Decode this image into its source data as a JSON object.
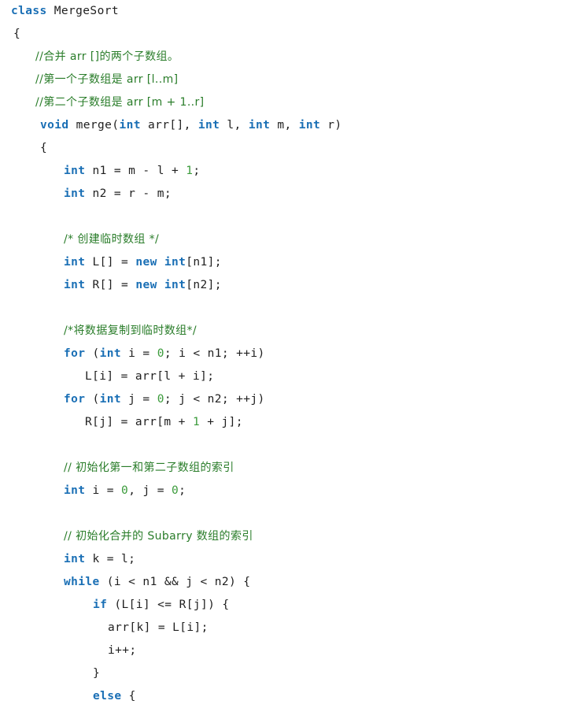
{
  "document": {
    "title": "MergeSort",
    "language": "Java",
    "background_color": "#ffffff",
    "colors": {
      "keyword": "#1a6fb5",
      "comment": "#2a7d2a",
      "number": "#3b9b3b",
      "plain": "#202020",
      "background": "#ffffff"
    }
  },
  "code": {
    "lines": [
      {
        "indent": 0,
        "tokens": [
          {
            "t": "keyword",
            "s": "class"
          },
          {
            "t": "plain",
            "s": " MergeSort"
          }
        ]
      },
      {
        "indent": 1,
        "tokens": [
          {
            "t": "plain",
            "s": "{"
          }
        ]
      },
      {
        "indent": 2,
        "tokens": [
          {
            "t": "comment",
            "s": "//合并 arr []的两个子数组。"
          }
        ]
      },
      {
        "indent": 2,
        "tokens": [
          {
            "t": "comment",
            "s": "//第一个子数组是 arr [l..m]"
          }
        ]
      },
      {
        "indent": 2,
        "tokens": [
          {
            "t": "comment",
            "s": "//第二个子数组是 arr [m + 1..r]"
          }
        ]
      },
      {
        "indent": 3,
        "tokens": [
          {
            "t": "keyword",
            "s": "void"
          },
          {
            "t": "plain",
            "s": " merge("
          },
          {
            "t": "keyword",
            "s": "int"
          },
          {
            "t": "plain",
            "s": " arr[], "
          },
          {
            "t": "keyword",
            "s": "int"
          },
          {
            "t": "plain",
            "s": " l, "
          },
          {
            "t": "keyword",
            "s": "int"
          },
          {
            "t": "plain",
            "s": " m, "
          },
          {
            "t": "keyword",
            "s": "int"
          },
          {
            "t": "plain",
            "s": " r)"
          }
        ]
      },
      {
        "indent": 3,
        "tokens": [
          {
            "t": "plain",
            "s": "{"
          }
        ]
      },
      {
        "indent": 4,
        "tokens": [
          {
            "t": "keyword",
            "s": "int"
          },
          {
            "t": "plain",
            "s": " n1 = m - l + "
          },
          {
            "t": "number",
            "s": "1"
          },
          {
            "t": "plain",
            "s": ";"
          }
        ]
      },
      {
        "indent": 4,
        "tokens": [
          {
            "t": "keyword",
            "s": "int"
          },
          {
            "t": "plain",
            "s": " n2 = r - m;"
          }
        ]
      },
      {
        "indent": 0,
        "blank": true,
        "tokens": []
      },
      {
        "indent": 4,
        "tokens": [
          {
            "t": "comment",
            "s": "/* 创建临时数组 */"
          }
        ]
      },
      {
        "indent": 4,
        "tokens": [
          {
            "t": "keyword",
            "s": "int"
          },
          {
            "t": "plain",
            "s": " L[] = "
          },
          {
            "t": "keyword",
            "s": "new"
          },
          {
            "t": "plain",
            "s": " "
          },
          {
            "t": "keyword",
            "s": "int"
          },
          {
            "t": "plain",
            "s": "[n1];"
          }
        ]
      },
      {
        "indent": 4,
        "tokens": [
          {
            "t": "keyword",
            "s": "int"
          },
          {
            "t": "plain",
            "s": " R[] = "
          },
          {
            "t": "keyword",
            "s": "new"
          },
          {
            "t": "plain",
            "s": " "
          },
          {
            "t": "keyword",
            "s": "int"
          },
          {
            "t": "plain",
            "s": "[n2];"
          }
        ]
      },
      {
        "indent": 0,
        "blank": true,
        "tokens": []
      },
      {
        "indent": 4,
        "tokens": [
          {
            "t": "comment",
            "s": "/*将数据复制到临时数组*/"
          }
        ]
      },
      {
        "indent": 4,
        "tokens": [
          {
            "t": "keyword",
            "s": "for"
          },
          {
            "t": "plain",
            "s": " ("
          },
          {
            "t": "keyword",
            "s": "int"
          },
          {
            "t": "plain",
            "s": " i = "
          },
          {
            "t": "number",
            "s": "0"
          },
          {
            "t": "plain",
            "s": "; i < n1; ++i)"
          }
        ]
      },
      {
        "indent": 5,
        "tokens": [
          {
            "t": "plain",
            "s": "L[i] = arr[l + i];"
          }
        ]
      },
      {
        "indent": 4,
        "tokens": [
          {
            "t": "keyword",
            "s": "for"
          },
          {
            "t": "plain",
            "s": " ("
          },
          {
            "t": "keyword",
            "s": "int"
          },
          {
            "t": "plain",
            "s": " j = "
          },
          {
            "t": "number",
            "s": "0"
          },
          {
            "t": "plain",
            "s": "; j < n2; ++j)"
          }
        ]
      },
      {
        "indent": 5,
        "tokens": [
          {
            "t": "plain",
            "s": "R[j] = arr[m + "
          },
          {
            "t": "number",
            "s": "1"
          },
          {
            "t": "plain",
            "s": " + j];"
          }
        ]
      },
      {
        "indent": 0,
        "blank": true,
        "tokens": []
      },
      {
        "indent": 4,
        "tokens": [
          {
            "t": "comment",
            "s": "// 初始化第一和第二子数组的索引"
          }
        ]
      },
      {
        "indent": 4,
        "tokens": [
          {
            "t": "keyword",
            "s": "int"
          },
          {
            "t": "plain",
            "s": " i = "
          },
          {
            "t": "number",
            "s": "0"
          },
          {
            "t": "plain",
            "s": ", j = "
          },
          {
            "t": "number",
            "s": "0"
          },
          {
            "t": "plain",
            "s": ";"
          }
        ]
      },
      {
        "indent": 0,
        "blank": true,
        "tokens": []
      },
      {
        "indent": 4,
        "tokens": [
          {
            "t": "comment",
            "s": "// 初始化合并的 Subarry 数组的索引"
          }
        ]
      },
      {
        "indent": 4,
        "tokens": [
          {
            "t": "keyword",
            "s": "int"
          },
          {
            "t": "plain",
            "s": " k = l;"
          }
        ]
      },
      {
        "indent": 4,
        "tokens": [
          {
            "t": "keyword",
            "s": "while"
          },
          {
            "t": "plain",
            "s": " (i < n1 && j < n2) {"
          }
        ]
      },
      {
        "indent": 6,
        "tokens": [
          {
            "t": "keyword",
            "s": "if"
          },
          {
            "t": "plain",
            "s": " (L[i] <= R[j]) {"
          }
        ]
      },
      {
        "indent": 7,
        "tokens": [
          {
            "t": "plain",
            "s": "arr[k] = L[i];"
          }
        ]
      },
      {
        "indent": 7,
        "tokens": [
          {
            "t": "plain",
            "s": "i++;"
          }
        ]
      },
      {
        "indent": 6,
        "tokens": [
          {
            "t": "plain",
            "s": "}"
          }
        ]
      },
      {
        "indent": 6,
        "tokens": [
          {
            "t": "keyword",
            "s": "else"
          },
          {
            "t": "plain",
            "s": " {"
          }
        ]
      }
    ]
  }
}
